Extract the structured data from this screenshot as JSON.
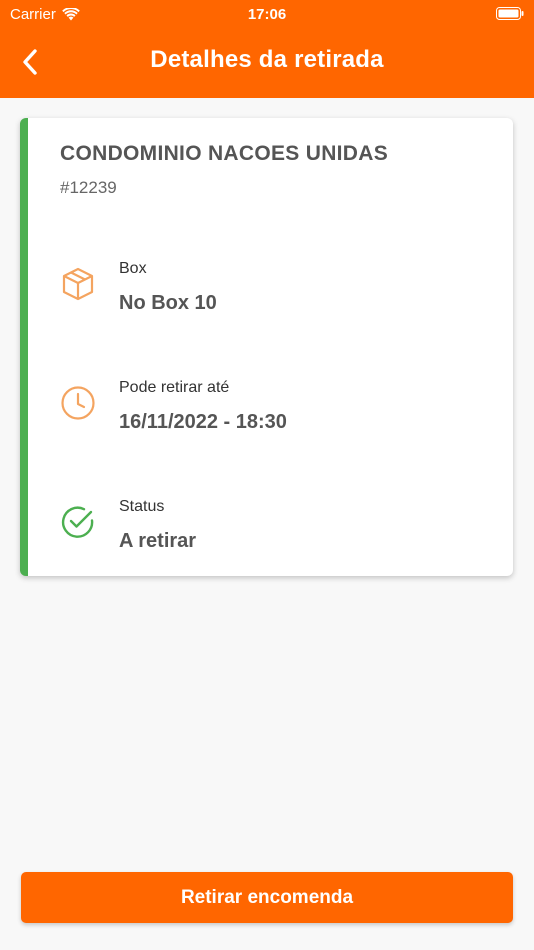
{
  "status_bar": {
    "carrier": "Carrier",
    "time": "17:06"
  },
  "header": {
    "title": "Detalhes da retirada",
    "back_icon": "chevron-left-icon",
    "background": "#ff6600"
  },
  "card": {
    "accent_color": "#4caf50",
    "condominium_name": "CONDOMINIO NACOES UNIDAS",
    "id": "#12239",
    "rows": [
      {
        "icon": "package-icon",
        "label": "Box",
        "value": "No Box 10",
        "icon_color": "#f4a460"
      },
      {
        "icon": "clock-icon",
        "label": "Pode retirar até",
        "value": "16/11/2022 - 18:30",
        "icon_color": "#f4a460"
      },
      {
        "icon": "check-circle-icon",
        "label": "Status",
        "value": "A retirar",
        "icon_color": "#4caf50"
      }
    ]
  },
  "action": {
    "label": "Retirar encomenda",
    "color": "#ff6600"
  }
}
